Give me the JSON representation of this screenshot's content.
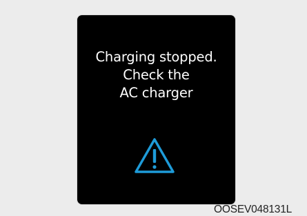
{
  "display": {
    "message_lines": [
      "Charging stopped.",
      "Check the",
      "AC charger"
    ],
    "warning_icon": "warning-triangle-icon",
    "warning_color": "#1e9bd8",
    "background_color": "#000000",
    "text_color": "#ffffff"
  },
  "figure": {
    "code": "OOSEV048131L"
  }
}
